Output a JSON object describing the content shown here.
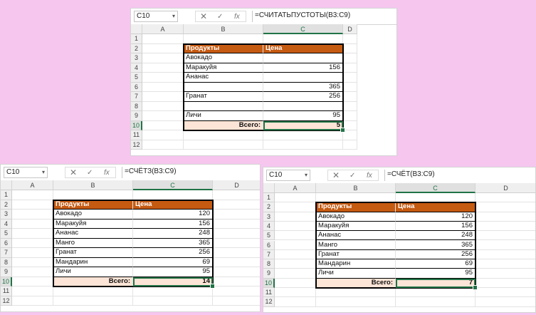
{
  "headers": {
    "corner": "",
    "colA": "A",
    "colB": "B",
    "colC": "C",
    "colD": "D"
  },
  "formula_icons": {
    "x": "✕",
    "check": "✓",
    "fx": "fx"
  },
  "windows": [
    {
      "id": "top",
      "name_box": "C10",
      "formula": "=СЧИТАТЬПУСТОТЫ(B3:C9)",
      "row_numbers": [
        "1",
        "2",
        "3",
        "4",
        "5",
        "6",
        "7",
        "8",
        "9",
        "10",
        "11",
        "12"
      ],
      "table_header": {
        "product": "Продукты",
        "price": "Цена"
      },
      "rows": [
        {
          "product": "Авокадо",
          "price": ""
        },
        {
          "product": "Маракуйя",
          "price": "156"
        },
        {
          "product": "Ананас",
          "price": ""
        },
        {
          "product": "",
          "price": "365"
        },
        {
          "product": "Гранат",
          "price": "256"
        },
        {
          "product": "",
          "price": ""
        },
        {
          "product": "Личи",
          "price": "95"
        }
      ],
      "total_label": "Всего:",
      "total_value": "5"
    },
    {
      "id": "bottom-left",
      "name_box": "C10",
      "formula": "=СЧЁТЗ(B3:C9)",
      "row_numbers": [
        "1",
        "2",
        "3",
        "4",
        "5",
        "6",
        "7",
        "8",
        "9",
        "10",
        "11",
        "12"
      ],
      "table_header": {
        "product": "Продукты",
        "price": "Цена"
      },
      "rows": [
        {
          "product": "Авокадо",
          "price": "120"
        },
        {
          "product": "Маракуйя",
          "price": "156"
        },
        {
          "product": "Ананас",
          "price": "248"
        },
        {
          "product": "Манго",
          "price": "365"
        },
        {
          "product": "Гранат",
          "price": "256"
        },
        {
          "product": "Мандарин",
          "price": "69"
        },
        {
          "product": "Личи",
          "price": "95"
        }
      ],
      "total_label": "Всего:",
      "total_value": "14"
    },
    {
      "id": "bottom-right",
      "name_box": "C10",
      "formula": "=СЧЁТ(B3:C9)",
      "row_numbers": [
        "1",
        "2",
        "3",
        "4",
        "5",
        "6",
        "7",
        "8",
        "9",
        "10",
        "11",
        "12"
      ],
      "table_header": {
        "product": "Продукты",
        "price": "Цена"
      },
      "rows": [
        {
          "product": "Авокадо",
          "price": "120"
        },
        {
          "product": "Маракуйя",
          "price": "156"
        },
        {
          "product": "Ананас",
          "price": "248"
        },
        {
          "product": "Манго",
          "price": "365"
        },
        {
          "product": "Гранат",
          "price": "256"
        },
        {
          "product": "Мандарин",
          "price": "69"
        },
        {
          "product": "Личи",
          "price": "95"
        }
      ],
      "total_label": "Всего:",
      "total_value": "7"
    }
  ]
}
